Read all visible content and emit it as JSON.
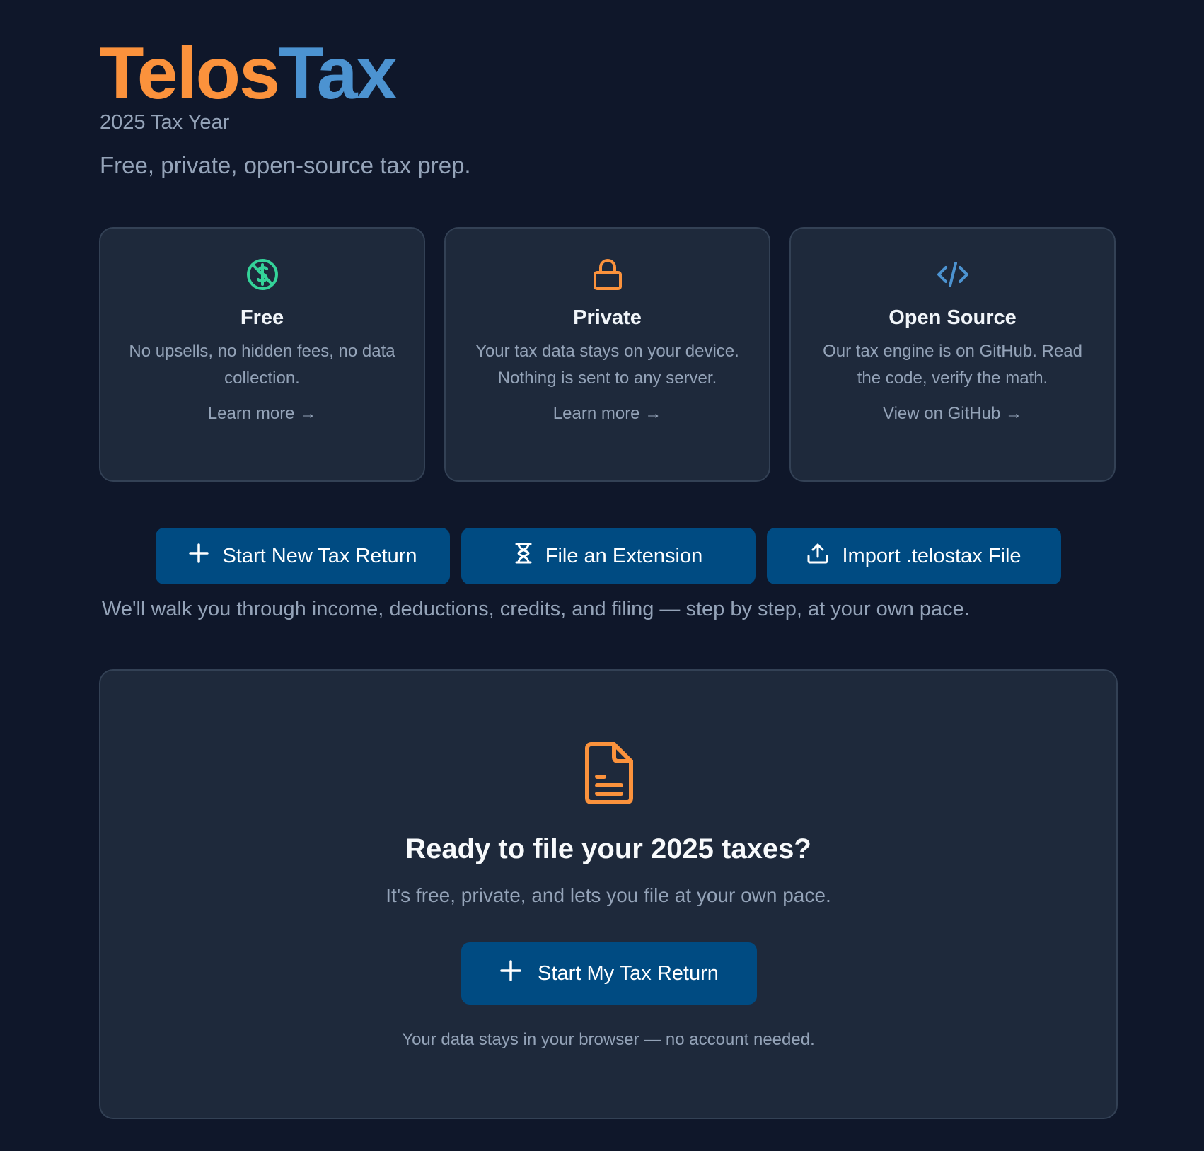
{
  "brand": {
    "part1": "Telos",
    "part2": "Tax",
    "color1": "#fb923c",
    "color2": "#4c93d1"
  },
  "tax_year": "2025 Tax Year",
  "tagline": "Free, private, open-source tax prep.",
  "features": [
    {
      "icon": "no-dollar-icon",
      "title": "Free",
      "description": "No upsells, no hidden fees, no data collection.",
      "link": "Learn more →",
      "icon_color": "#34d399"
    },
    {
      "icon": "lock-icon",
      "title": "Private",
      "description": "Your tax data stays on your device. Nothing is sent to any server.",
      "link": "Learn more →",
      "icon_color": "#fb923c"
    },
    {
      "icon": "code-icon",
      "title": "Open Source",
      "description": "Our tax engine is on GitHub. Read the code, verify the math.",
      "link": "View on GitHub →",
      "icon_color": "#4c93d1"
    }
  ],
  "actions": {
    "start_new": "Start New Tax Return",
    "extension": "File an Extension",
    "import": "Import .telostax File"
  },
  "walkthrough": "We'll walk you through income, deductions, credits, and filing — step by step, at your own pace.",
  "cta": {
    "title": "Ready to file your 2025 taxes?",
    "subtitle": "It's free, private, and lets you file at your own pace.",
    "button": "Start My Tax Return",
    "note": "Your data stays in your browser — no account needed."
  },
  "colors": {
    "background": "#0f172a",
    "card": "#1e293b",
    "button": "#004b82",
    "muted_text": "#94a3b8"
  }
}
